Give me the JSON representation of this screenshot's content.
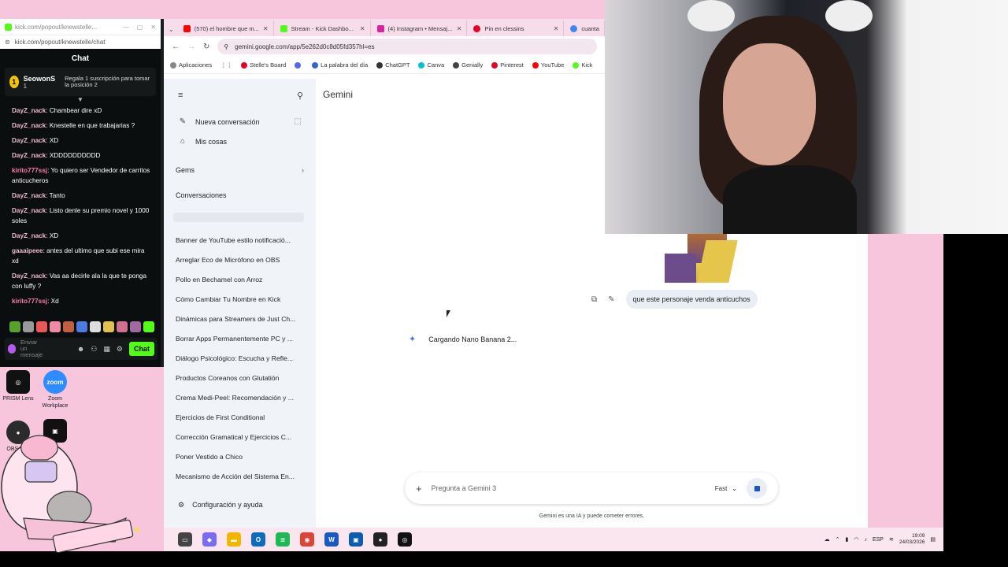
{
  "kick": {
    "window_url": "kick.com/popout/knewstelle...",
    "url": "kick.com/popout/knewstelle/chat",
    "header": "Chat",
    "subscriber": {
      "rank": "1",
      "name": "SeowonS",
      "count": "1",
      "message": "Regala 1 suscripción para tomar la posición 2"
    },
    "messages": [
      {
        "user": "DayZ_nack",
        "text": "Chambear dire xD",
        "alt": false
      },
      {
        "user": "DayZ_nack",
        "text": "Knestelle en que trabajarias ?",
        "alt": false
      },
      {
        "user": "DayZ_nack",
        "text": "XD",
        "alt": false
      },
      {
        "user": "DayZ_nack",
        "text": "XDDDDDDDDDD",
        "alt": false
      },
      {
        "user": "kirito777ssj",
        "text": "Yo quiero ser Vendedor de carritos anticucheros",
        "alt": true
      },
      {
        "user": "DayZ_nack",
        "text": "Tanto",
        "alt": false
      },
      {
        "user": "DayZ_nack",
        "text": "Listo denle su premio novel y 1000 soles",
        "alt": false
      },
      {
        "user": "DayZ_nack",
        "text": "XD",
        "alt": false
      },
      {
        "user": "gaaaipeee",
        "text": "antes del ultimo que subi ese mira xd",
        "alt": false
      },
      {
        "user": "DayZ_nack",
        "text": "Vas aa decirle ala la que te ponga con luffy ?",
        "alt": false
      },
      {
        "user": "kirito777ssj",
        "text": "Xd",
        "alt": true
      }
    ],
    "input_placeholder": "Enviar un mensaje",
    "chat_button": "Chat"
  },
  "desktop_icons": [
    {
      "label": "PRISM Lens",
      "color": "#111111",
      "glyph": "◎"
    },
    {
      "label": "Zoom Workplace",
      "color": "#2d8cff",
      "glyph": "zoom"
    },
    {
      "label": "OBS St...",
      "color": "#2b2b2b",
      "glyph": "●"
    },
    {
      "label": "",
      "color": "#111111",
      "glyph": "▣"
    }
  ],
  "browser": {
    "tabs": [
      {
        "title": "(570) el hombre que m...",
        "color": "#ff0000"
      },
      {
        "title": "Stream - Kick Dashbo...",
        "color": "#53fc18"
      },
      {
        "title": "(4) Instagram • Mensaj...",
        "color": "#d6249f"
      },
      {
        "title": "Pin en clessins",
        "color": "#e60023"
      },
      {
        "title": "cuantas...",
        "color": "#4285f4"
      }
    ],
    "address": "gemini.google.com/app/5e262d0c8d05fd357hl=es",
    "bookmarks": [
      {
        "label": "Aplicaciones",
        "color": "#888888"
      },
      {
        "label": "Stelle's Board",
        "color": "#e60023"
      },
      {
        "label": "",
        "color": "#5865f2"
      },
      {
        "label": "La palabra del día",
        "color": "#3366cc"
      },
      {
        "label": "ChatGPT",
        "color": "#333333"
      },
      {
        "label": "Canva",
        "color": "#00c4cc"
      },
      {
        "label": "Genially",
        "color": "#444444"
      },
      {
        "label": "Pinterest",
        "color": "#e60023"
      },
      {
        "label": "YouTube",
        "color": "#ff0000"
      },
      {
        "label": "Kick",
        "color": "#53fc18"
      }
    ]
  },
  "gemini": {
    "title": "Gemini",
    "new_chat": "Nueva conversación",
    "my_stuff": "Mis cosas",
    "gems": "Gems",
    "conversations_label": "Conversaciones",
    "conversations": [
      "Banner de YouTube estilo notificació...",
      "Arreglar Eco de Micrófono en OBS",
      "Pollo en Bechamel con Arroz",
      "Cómo Cambiar Tu Nombre en Kick",
      "Dinámicas para Streamers de Just Ch...",
      "Borrar Apps Permanentemente PC y ...",
      "Diálogo Psicológico: Escucha y Refle...",
      "Productos Coreanos con Glutatión",
      "Crema Medi-Peel: Recomendación y ...",
      "Ejercicios de First Conditional",
      "Corrección Gramatical y Ejercicios C...",
      "Poner Vestido a Chico",
      "Mecanismo de Acción del Sistema En..."
    ],
    "settings": "Configuración y ayuda",
    "user_message": "que este personaje venda anticuchos",
    "loading": "Cargando Nano Banana 2...",
    "prompt_placeholder": "Pregunta a Gemini 3",
    "mode": "Fast",
    "disclaimer": "Gemini es una IA y puede cometer errores."
  },
  "taskbar": {
    "apps": [
      {
        "name": "task-view",
        "color": "#444444",
        "glyph": "▭"
      },
      {
        "name": "copilot",
        "color": "#7a6cf0",
        "glyph": "◆"
      },
      {
        "name": "file-explorer",
        "color": "#f2b600",
        "glyph": "▬"
      },
      {
        "name": "outlook",
        "color": "#0f6cbd",
        "glyph": "O"
      },
      {
        "name": "spotify",
        "color": "#1db954",
        "glyph": "≋"
      },
      {
        "name": "chrome",
        "color": "#db4437",
        "glyph": "◉"
      },
      {
        "name": "word",
        "color": "#185abd",
        "glyph": "W"
      },
      {
        "name": "app-blue",
        "color": "#0b5cad",
        "glyph": "▣"
      },
      {
        "name": "obs",
        "color": "#222222",
        "glyph": "●"
      },
      {
        "name": "prism",
        "color": "#111111",
        "glyph": "◎"
      }
    ],
    "tray_lang": "ESP",
    "time": "19:09",
    "date": "24/03/2026"
  }
}
